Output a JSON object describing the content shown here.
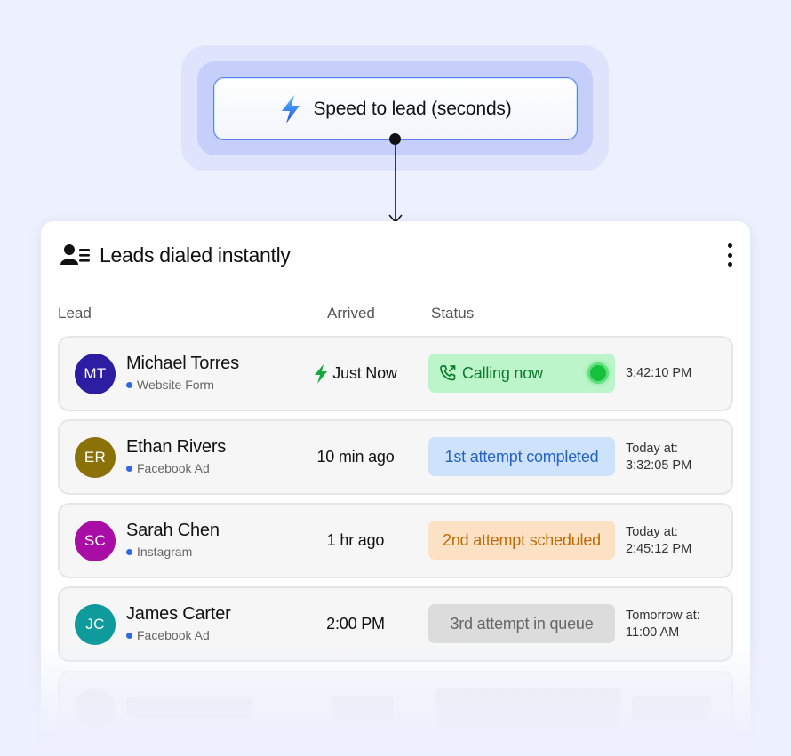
{
  "header": {
    "pill_label": "Speed to lead (seconds)",
    "pill_icon": "lightning-bolt-icon"
  },
  "card": {
    "title": "Leads dialed instantly",
    "title_icon": "people-list-icon",
    "menu_icon": "kebab-menu-icon",
    "columns": {
      "lead": "Lead",
      "arrived": "Arrived",
      "status": "Status"
    },
    "rows": [
      {
        "initials": "MT",
        "avatar_color": "#2c1da3",
        "name": "Michael Torres",
        "source": "Website Form",
        "arrived": "Just Now",
        "arrived_icon": "lightning-bolt-icon",
        "status": "Calling now",
        "status_icon": "phone-call-icon",
        "status_kind": "calling",
        "time_line1": "3:42:10 PM",
        "time_line2": ""
      },
      {
        "initials": "ER",
        "avatar_color": "#8a7208",
        "name": "Ethan Rivers",
        "source": "Facebook Ad",
        "arrived": "10 min ago",
        "status": "1st attempt completed",
        "status_kind": "completed",
        "time_line1": "Today at:",
        "time_line2": "3:32:05 PM"
      },
      {
        "initials": "SC",
        "avatar_color": "#a80ea5",
        "name": "Sarah Chen",
        "source": "Instagram",
        "arrived": "1 hr ago",
        "status": "2nd attempt scheduled",
        "status_kind": "scheduled",
        "time_line1": "Today at:",
        "time_line2": "2:45:12 PM"
      },
      {
        "initials": "JC",
        "avatar_color": "#0f9a9c",
        "name": "James Carter",
        "source": "Facebook Ad",
        "arrived": "2:00 PM",
        "status": "3rd attempt in queue",
        "status_kind": "queue",
        "time_line1": "Tomorrow at:",
        "time_line2": "11:00 AM"
      }
    ]
  },
  "colors": {
    "accent": "#5f7cf0",
    "calling_bg": "#bdf5cb",
    "calling_fg": "#0b7a2b",
    "completed_bg": "#cfe2fb",
    "completed_fg": "#2563c9",
    "scheduled_bg": "#fde1c4",
    "scheduled_fg": "#c06a05",
    "queue_bg": "#dcdcdc",
    "queue_fg": "#666666"
  }
}
